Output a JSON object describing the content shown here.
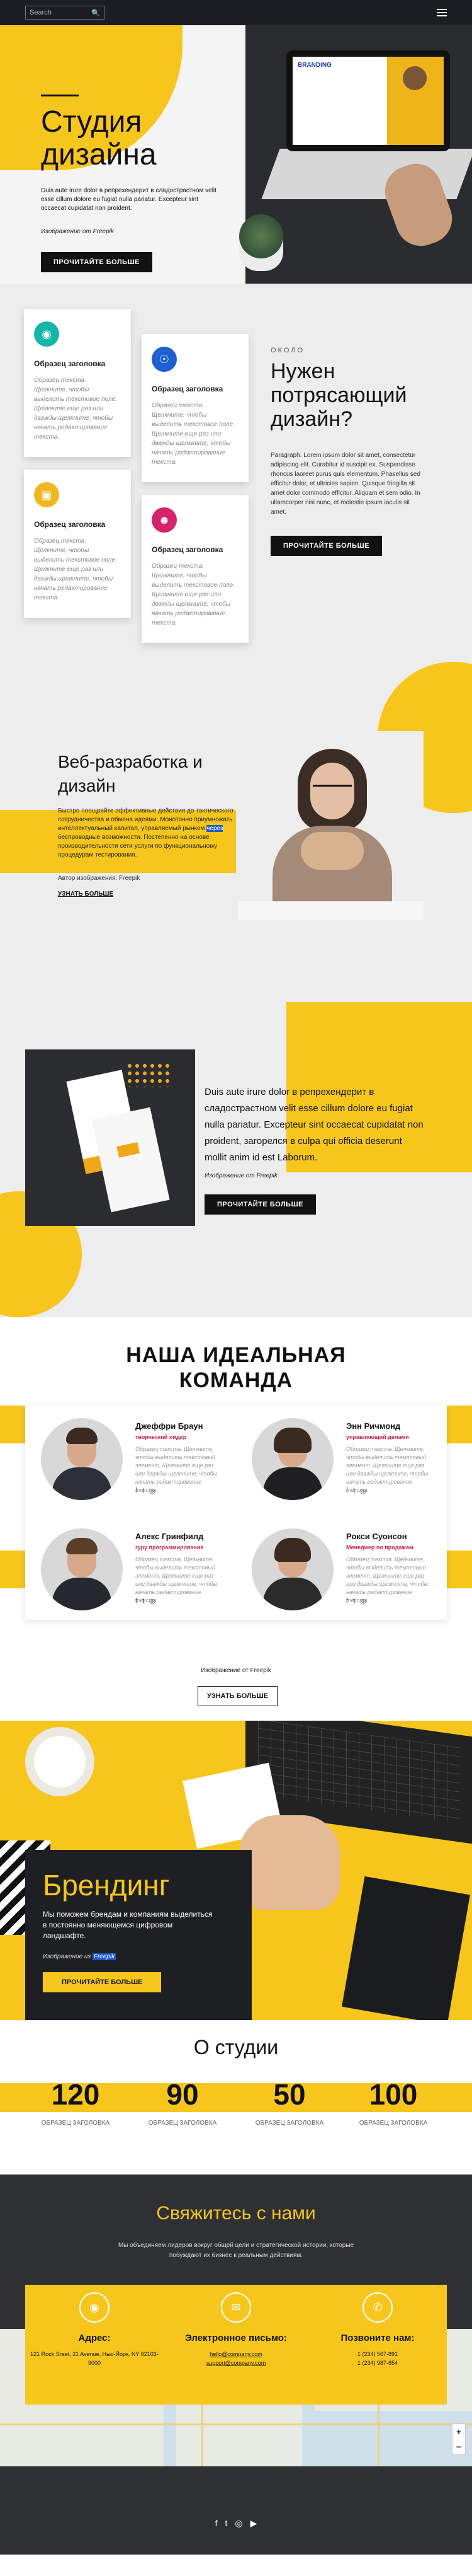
{
  "header": {
    "search_placeholder": "Search",
    "search_icon": "magnifier",
    "menu_icon": "hamburger"
  },
  "hero": {
    "title_line1": "Студия",
    "title_line2": "дизайна",
    "lead": "Duis aute irure dolor в репрехендерит в сладострастном velit esse cillum dolore eu fugiat nulla pariatur. Excepteur sint occaecat cupidatat non proident.",
    "credit": "Изображение от Freepik",
    "button": "ПРОЧИТАЙТЕ БОЛЬШЕ",
    "laptop_screen_text": "BRANDING"
  },
  "features": {
    "cards": [
      {
        "title": "Образец заголовка",
        "text": "Образец текста. Щелкните, чтобы выделить текстовое поле. Щелкните еще раз или дважды щелкните, чтобы начать редактирование текста.",
        "icon": "camera-icon",
        "color": "#16b5a5"
      },
      {
        "title": "Образец заголовка",
        "text": "Образец текста. Щелкните, чтобы выделить текстовое поле. Щелкните еще раз или дважды щелкните, чтобы начать редактирование текста.",
        "icon": "globe-icon",
        "color": "#1e5fd1"
      },
      {
        "title": "Образец заголовка",
        "text": "Образец текста. Щелкните, чтобы выделить текстовое поле. Щелкните еще раз или дважды щелкните, чтобы начать редактирование текста.",
        "icon": "truck-icon",
        "color": "#f1b81e"
      },
      {
        "title": "Образец заголовка",
        "text": "Образец текста. Щелкните, чтобы выделить текстовое поле. Щелкните еще раз или дважды щелкните, чтобы начать редактирование текста.",
        "icon": "user-icon",
        "color": "#d6246a"
      }
    ],
    "kicker": "ОКОЛО",
    "title": "Нужен потрясающий дизайн?",
    "text": "Paragraph. Lorem ipsum dolor sit amet, consectetur adipiscing elit. Curabitur id suscipit ex. Suspendisse rhoncus laoreet purus quis elementum. Phasellus sed efficitur dolor, et ultricies sapien. Quisque fringilla sit amet dolor commodo efficitur. Aliquam et sem odio. In ullamcorper nisi nunc, et molestie ipsum iaculis sit amet.",
    "button": "ПРОЧИТАЙТЕ БОЛЬШЕ"
  },
  "webdev": {
    "title": "Веб-разработка и дизайн",
    "text_before": "Быстро поощряйте эффективные действия до тактического сотрудничества и обмена идеями. Монотонно приумножать интеллектуальный капитал, управляемый рынком ",
    "text_highlight": "через",
    "text_after": " беспроводные возможности. Постепенно на основе производительности сети услуги по функциональному процедурам тестирования.",
    "credit": "Автор изображения: Freepik",
    "link": "УЗНАТЬ БОЛЬШЕ"
  },
  "biz": {
    "text": "Duis aute irure dolor в репрехендерит в сладострастном velit esse cillum dolore eu fugiat nulla pariatur. Excepteur sint occaecat cupidatat non proident, загорелся в culpa qui officia deserunt mollit anim id est Laborum.",
    "credit": "Изображение от Freepik",
    "button": "ПРОЧИТАЙТЕ БОЛЬШЕ"
  },
  "team": {
    "title_line1": "НАША ИДЕАЛЬНАЯ",
    "title_line2": "КОМАНДА",
    "members": [
      {
        "name": "Джеффри Браун",
        "role": "творческий лидер",
        "text": "Образец текста. Щелкните, чтобы выделить текстовый элемент. Щелкните еще раз или дважды щелкните, чтобы начать редактирование текста."
      },
      {
        "name": "Энн Ричмонд",
        "role": "управляющий делами",
        "text": "Образец текста. Щелкните, чтобы выделить текстовый элемент. Щелкните еще раз или дважды щелкните, чтобы начать редактирование текста."
      },
      {
        "name": "Алекс Гринфилд",
        "role": "гуру программирования",
        "text": "Образец текста. Щелкните, чтобы выделить текстовый элемент. Щелкните еще раз или дважды щелкните, чтобы начать редактирование текста."
      },
      {
        "name": "Рокси Суонсон",
        "role": "Менеджер по продажам",
        "text": "Образец текста. Щелкните, чтобы выделить текстовый элемент. Щелкните еще раз или дважды щелкните, чтобы начать редактирование текста."
      }
    ],
    "social_icons": [
      "f",
      "t",
      "◎"
    ],
    "credit": "Изображение от Freepik",
    "button": "УЗНАТЬ БОЛЬШЕ"
  },
  "branding": {
    "title": "Брендинг",
    "text": "Мы поможем брендам и компаниям выделиться в постоянно меняющемся цифровом ландшафте.",
    "credit_prefix": "Изображение из",
    "credit_highlight": "Freepik",
    "button": "ПРОЧИТАЙТЕ БОЛЬШЕ"
  },
  "stats": {
    "title": "О студии",
    "items": [
      {
        "value": "120",
        "label": "ОБРАЗЕЦ ЗАГОЛОВКА"
      },
      {
        "value": "90",
        "label": "ОБРАЗЕЦ ЗАГОЛОВКА"
      },
      {
        "value": "50",
        "label": "ОБРАЗЕЦ ЗАГОЛОВКА"
      },
      {
        "value": "100",
        "label": "ОБРАЗЕЦ ЗАГОЛОВКА"
      }
    ]
  },
  "contact": {
    "title": "Свяжитесь с нами",
    "sub": "Мы объединяем лидеров вокруг общей цели и стратегической истории, которые побуждают их бизнес к реальным действиям.",
    "address_label": "Адрес:",
    "address": "121 Rock Sreet, 21 Avenue, Нью-Йорк, NY 92103-9000",
    "email_label": "Электронное письмо:",
    "email1": "hello@company.com",
    "email2": "support@company.com",
    "phone_label": "Позвоните нам:",
    "phone1": "1 (234) 567-891",
    "phone2": "1 (234) 987-654",
    "map_zoom_in": "+",
    "map_zoom_out": "−",
    "social_icons": [
      "f",
      "t",
      "◎",
      "▶"
    ]
  },
  "colors": {
    "accent": "#f7c61d",
    "dark": "#1e1f22",
    "link_highlight": "#1e56c9"
  }
}
